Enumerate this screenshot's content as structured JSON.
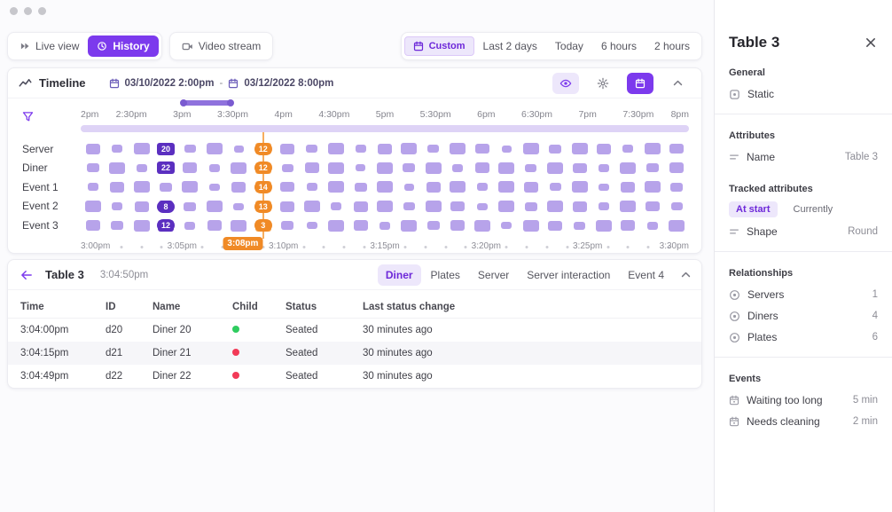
{
  "window": {
    "control_dots": 3
  },
  "colors": {
    "primary": "#7c3aed",
    "primary_light": "#ede7fb",
    "primary_dark": "#6d28d9",
    "bar": "#b7a3ea",
    "bar_dark": "#5b2fc0",
    "overview": "#ded3f6",
    "brush": "#8f72dd",
    "orange": "#f6a44c",
    "orange_deep": "#f08a26",
    "green": "#2fcc5f",
    "red": "#f23a57"
  },
  "toolbar": {
    "left_groups": [
      {
        "buttons": [
          {
            "label": "Live view",
            "icon": "live-icon",
            "active": false
          },
          {
            "label": "History",
            "icon": "history-icon",
            "active": true
          }
        ]
      },
      {
        "buttons": [
          {
            "label": "Video stream",
            "icon": "video-icon",
            "active": false
          }
        ]
      }
    ],
    "range_buttons": [
      {
        "label": "Custom",
        "icon": "calendar-icon",
        "active": true
      },
      {
        "label": "Last 2 days",
        "active": false
      },
      {
        "label": "Today",
        "active": false
      },
      {
        "label": "6 hours",
        "active": false
      },
      {
        "label": "2 hours",
        "active": false
      }
    ]
  },
  "timeline": {
    "title": "Timeline",
    "date_start": "03/10/2022 2:00pm",
    "date_separator": "-",
    "date_end": "03/12/2022 8:00pm",
    "axis_top": [
      "2pm",
      "2:30pm",
      "3pm",
      "3:30pm",
      "4pm",
      "4:30pm",
      "5pm",
      "5:30pm",
      "6pm",
      "6:30pm",
      "7pm",
      "7:30pm",
      "8pm"
    ],
    "brush": {
      "from_label": "3pm",
      "to_label": "3:30pm"
    },
    "slots_per_row": 25,
    "selected_slot": 7,
    "axis_bottom": {
      "total_minutes": 30,
      "labels": [
        {
          "minute": 0,
          "text": "3:00pm"
        },
        {
          "minute": 5,
          "text": "3:05pm"
        },
        {
          "minute": 8,
          "text": "3:08pm",
          "highlight": true
        },
        {
          "minute": 10,
          "text": "3:10pm"
        },
        {
          "minute": 15,
          "text": "3:15pm"
        },
        {
          "minute": 20,
          "text": "3:20pm"
        },
        {
          "minute": 25,
          "text": "3:25pm"
        },
        {
          "minute": 30,
          "text": "3:30pm"
        }
      ]
    },
    "rows": [
      {
        "label": "Server",
        "dark_badge": {
          "slot": 3,
          "value": "20"
        },
        "orange_badge": {
          "slot": 7,
          "value": "12"
        },
        "bars": [
          [
            16,
            12
          ],
          [
            12,
            9
          ],
          [
            18,
            13
          ],
          [
            20,
            14
          ],
          [
            13,
            9
          ],
          [
            18,
            13
          ],
          [
            11,
            8
          ],
          [
            18,
            13
          ],
          [
            16,
            12
          ],
          [
            13,
            9
          ],
          [
            18,
            13
          ],
          [
            12,
            9
          ],
          [
            16,
            12
          ],
          [
            18,
            13
          ],
          [
            13,
            9
          ],
          [
            18,
            13
          ],
          [
            16,
            11
          ],
          [
            11,
            8
          ],
          [
            18,
            13
          ],
          [
            14,
            10
          ],
          [
            18,
            13
          ],
          [
            16,
            12
          ],
          [
            12,
            9
          ],
          [
            18,
            13
          ],
          [
            16,
            11
          ]
        ]
      },
      {
        "label": "Diner",
        "dark_badge": {
          "slot": 3,
          "value": "22"
        },
        "orange_badge": {
          "slot": 7,
          "value": "12"
        },
        "bars": [
          [
            14,
            10
          ],
          [
            18,
            13
          ],
          [
            12,
            9
          ],
          [
            20,
            14
          ],
          [
            16,
            12
          ],
          [
            12,
            9
          ],
          [
            18,
            13
          ],
          [
            18,
            13
          ],
          [
            13,
            9
          ],
          [
            16,
            12
          ],
          [
            18,
            13
          ],
          [
            11,
            8
          ],
          [
            18,
            13
          ],
          [
            14,
            10
          ],
          [
            18,
            13
          ],
          [
            12,
            9
          ],
          [
            16,
            12
          ],
          [
            18,
            13
          ],
          [
            13,
            9
          ],
          [
            18,
            13
          ],
          [
            16,
            11
          ],
          [
            12,
            9
          ],
          [
            18,
            13
          ],
          [
            14,
            10
          ],
          [
            16,
            12
          ]
        ]
      },
      {
        "label": "Event 1",
        "orange_badge": {
          "slot": 7,
          "value": "14"
        },
        "bars": [
          [
            12,
            9
          ],
          [
            16,
            12
          ],
          [
            18,
            13
          ],
          [
            14,
            10
          ],
          [
            18,
            13
          ],
          [
            12,
            8
          ],
          [
            16,
            12
          ],
          [
            18,
            13
          ],
          [
            16,
            11
          ],
          [
            12,
            9
          ],
          [
            18,
            13
          ],
          [
            14,
            10
          ],
          [
            18,
            13
          ],
          [
            11,
            8
          ],
          [
            16,
            12
          ],
          [
            18,
            13
          ],
          [
            12,
            9
          ],
          [
            18,
            13
          ],
          [
            16,
            12
          ],
          [
            13,
            9
          ],
          [
            18,
            13
          ],
          [
            12,
            8
          ],
          [
            16,
            12
          ],
          [
            18,
            13
          ],
          [
            14,
            10
          ]
        ]
      },
      {
        "label": "Event 2",
        "dark_badge": {
          "slot": 3,
          "value": "8"
        },
        "orange_badge": {
          "slot": 7,
          "value": "13"
        },
        "bars": [
          [
            18,
            13
          ],
          [
            12,
            9
          ],
          [
            16,
            12
          ],
          [
            16,
            13
          ],
          [
            14,
            10
          ],
          [
            18,
            13
          ],
          [
            12,
            8
          ],
          [
            18,
            13
          ],
          [
            16,
            12
          ],
          [
            18,
            13
          ],
          [
            12,
            9
          ],
          [
            16,
            12
          ],
          [
            18,
            13
          ],
          [
            13,
            9
          ],
          [
            18,
            13
          ],
          [
            16,
            11
          ],
          [
            12,
            8
          ],
          [
            18,
            13
          ],
          [
            14,
            10
          ],
          [
            18,
            13
          ],
          [
            16,
            12
          ],
          [
            12,
            9
          ],
          [
            18,
            13
          ],
          [
            16,
            11
          ],
          [
            13,
            9
          ]
        ]
      },
      {
        "label": "Event 3",
        "dark_badge": {
          "slot": 3,
          "value": "12"
        },
        "orange_badge": {
          "slot": 7,
          "value": "3"
        },
        "bars": [
          [
            16,
            12
          ],
          [
            14,
            10
          ],
          [
            18,
            13
          ],
          [
            18,
            13
          ],
          [
            12,
            9
          ],
          [
            16,
            12
          ],
          [
            18,
            13
          ],
          [
            18,
            13
          ],
          [
            14,
            10
          ],
          [
            12,
            8
          ],
          [
            18,
            13
          ],
          [
            16,
            12
          ],
          [
            12,
            9
          ],
          [
            18,
            13
          ],
          [
            14,
            10
          ],
          [
            16,
            12
          ],
          [
            18,
            13
          ],
          [
            12,
            8
          ],
          [
            18,
            13
          ],
          [
            16,
            11
          ],
          [
            13,
            9
          ],
          [
            18,
            13
          ],
          [
            16,
            12
          ],
          [
            12,
            9
          ],
          [
            18,
            13
          ]
        ]
      }
    ]
  },
  "detail": {
    "title": "Table 3",
    "time": "3:04:50pm",
    "tabs": [
      {
        "label": "Diner",
        "active": true
      },
      {
        "label": "Plates",
        "active": false
      },
      {
        "label": "Server",
        "active": false
      },
      {
        "label": "Server interaction",
        "active": false
      },
      {
        "label": "Event 4",
        "active": false
      }
    ],
    "table": {
      "columns": [
        "Time",
        "ID",
        "Name",
        "Child",
        "Status",
        "Last status change"
      ],
      "rows": [
        {
          "time": "3:04:00pm",
          "id": "d20",
          "name": "Diner 20",
          "child": "green",
          "status": "Seated",
          "last_change": "30 minutes ago"
        },
        {
          "time": "3:04:15pm",
          "id": "d21",
          "name": "Diner 21",
          "child": "red",
          "status": "Seated",
          "last_change": "30 minutes ago"
        },
        {
          "time": "3:04:49pm",
          "id": "d22",
          "name": "Diner 22",
          "child": "red",
          "status": "Seated",
          "last_change": "30 minutes ago"
        }
      ]
    }
  },
  "sidebar": {
    "title": "Table 3",
    "sections": [
      {
        "heading": "General",
        "divider_after": true,
        "items": [
          {
            "icon": "static-icon",
            "label": "Static",
            "value": ""
          }
        ]
      },
      {
        "heading": "Attributes",
        "divider_after": false,
        "items": [
          {
            "icon": "attribute-icon",
            "label": "Name",
            "value": "Table 3"
          }
        ]
      },
      {
        "heading": "Tracked attributes",
        "divider_after": true,
        "chips": [
          {
            "label": "At start",
            "active": true
          },
          {
            "label": "Currently",
            "active": false
          }
        ],
        "items": [
          {
            "icon": "attribute-icon",
            "label": "Shape",
            "value": "Round"
          }
        ]
      },
      {
        "heading": "Relationships",
        "divider_after": true,
        "items": [
          {
            "icon": "relationship-icon",
            "label": "Servers",
            "value": "1"
          },
          {
            "icon": "relationship-icon",
            "label": "Diners",
            "value": "4"
          },
          {
            "icon": "relationship-icon",
            "label": "Plates",
            "value": "6"
          }
        ]
      },
      {
        "heading": "Events",
        "divider_after": false,
        "items": [
          {
            "icon": "event-icon",
            "label": "Waiting too long",
            "value": "5 min"
          },
          {
            "icon": "event-icon",
            "label": "Needs cleaning",
            "value": "2 min"
          }
        ]
      }
    ]
  }
}
